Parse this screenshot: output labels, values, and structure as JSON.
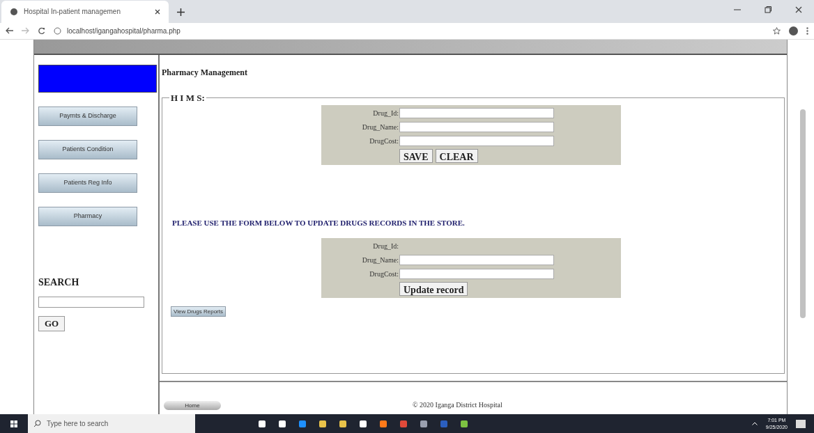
{
  "browser": {
    "tab_title": "Hospital In-patient managemen",
    "url": "localhost/igangahospital/pharma.php"
  },
  "sidebar": {
    "menu": [
      {
        "label": "Paymts & Discharge"
      },
      {
        "label": "Patients Condition"
      },
      {
        "label": "Patients Reg Info"
      },
      {
        "label": "Pharmacy"
      }
    ],
    "search_label": "SEARCH",
    "go": "GO"
  },
  "page_title": "Pharmacy Management",
  "fieldset_legend": "H I M S:",
  "add_form": {
    "fields": [
      {
        "label": "Drug_Id:",
        "kind": "input"
      },
      {
        "label": "Drug_Name:",
        "kind": "input"
      },
      {
        "label": "DrugCost:",
        "kind": "input"
      }
    ],
    "buttons": [
      "SAVE",
      "CLEAR"
    ]
  },
  "update_notice": "PLEASE USE THE FORM BELOW TO UPDATE DRUGS RECORDS IN THE STORE.",
  "update_form": {
    "fields": [
      {
        "label": "Drug_Id:",
        "kind": "text"
      },
      {
        "label": "Drug_Name:",
        "kind": "input"
      },
      {
        "label": "DrugCost:",
        "kind": "input"
      }
    ],
    "buttons": [
      "Update record"
    ]
  },
  "reports_button": "View Drugs Reports",
  "footer": {
    "home": "Home",
    "copyright": "© 2020 Iganga District Hospital"
  },
  "taskbar": {
    "search_placeholder": "Type here to search",
    "time": "7:01 PM",
    "date": "9/25/2020"
  }
}
